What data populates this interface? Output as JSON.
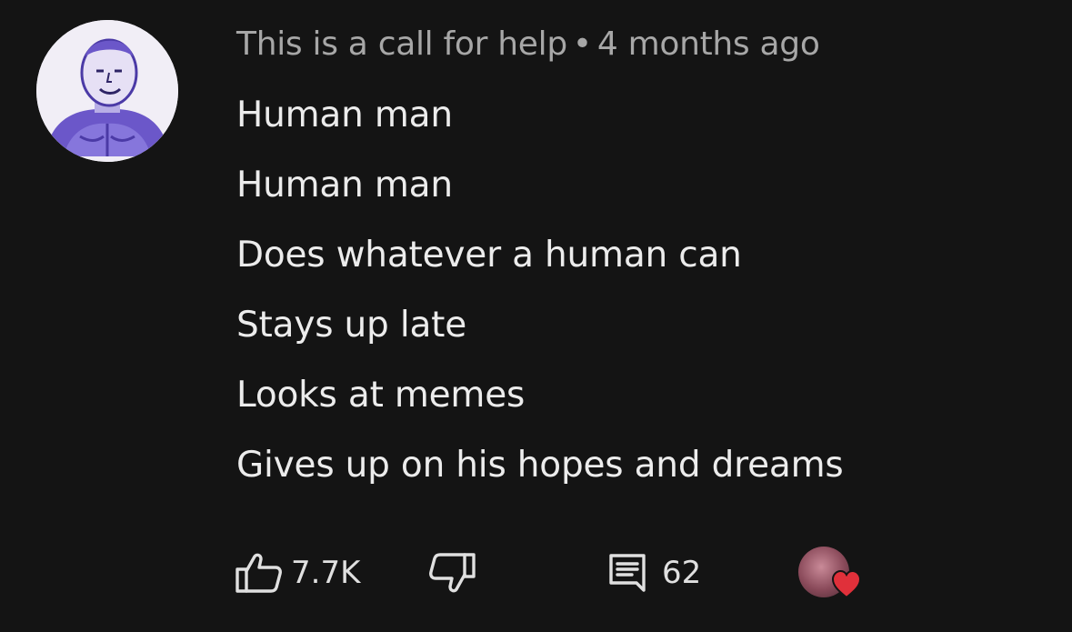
{
  "comment": {
    "author": "This is a call for help",
    "separator": "•",
    "timestamp": "4 months ago",
    "lines": [
      "Human man",
      "Human man",
      "Does whatever a human can",
      "Stays up late",
      "Looks at memes",
      "Gives up on his hopes and dreams"
    ],
    "actions": {
      "like_count": "7.7K",
      "reply_count": "62"
    }
  },
  "icons": {
    "like": "thumbs-up-icon",
    "dislike": "thumbs-down-icon",
    "replies": "comment-icon",
    "heart": "heart-icon"
  },
  "colors": {
    "background": "#141414",
    "avatar_purple": "#6b57c9",
    "heart_red": "#e0303a"
  }
}
